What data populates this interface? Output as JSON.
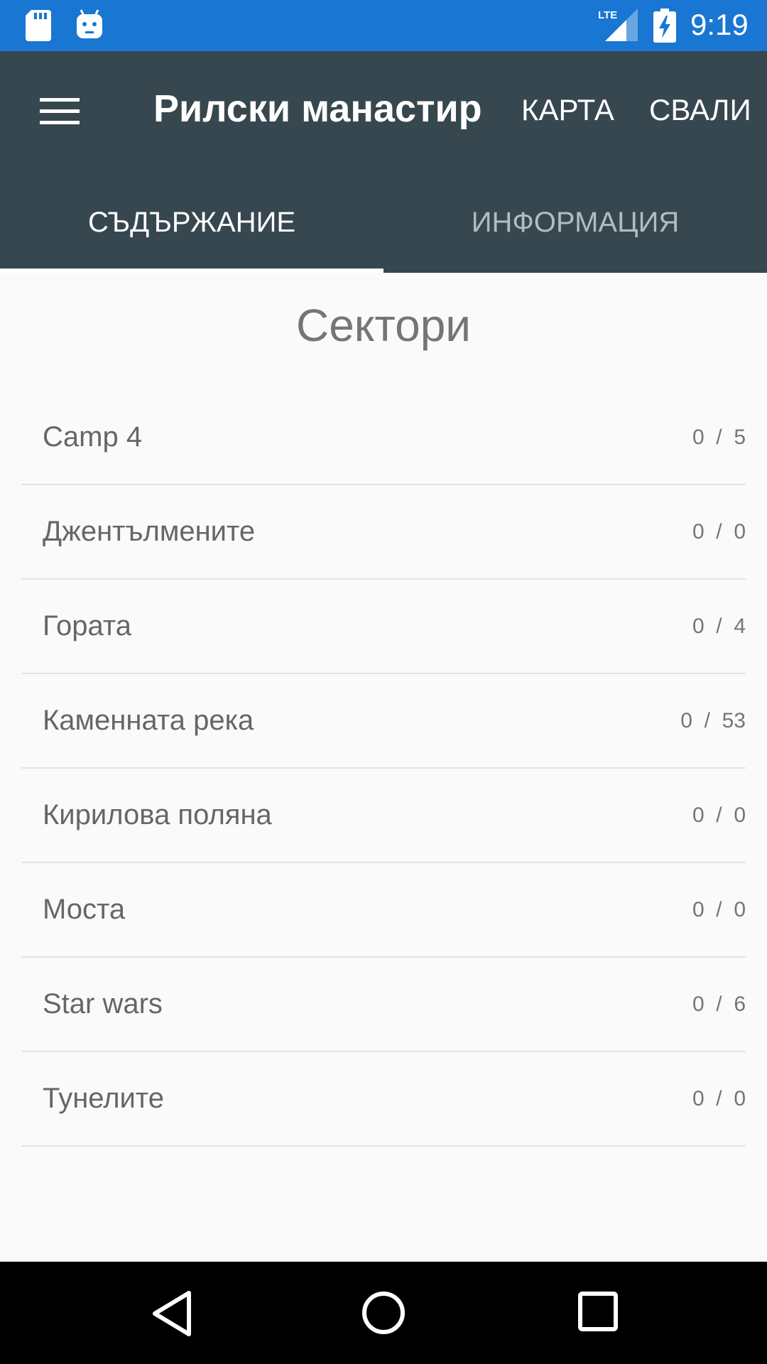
{
  "status_bar": {
    "time": "9:19",
    "network": "LTE",
    "icons": [
      "sd-card-icon",
      "android-debug-icon",
      "lte-signal-icon",
      "battery-charging-icon"
    ]
  },
  "app_bar": {
    "title": "Рилски манастир",
    "actions": {
      "map": "КАРТА",
      "download": "СВАЛИ"
    },
    "menu_icon": "hamburger-menu-icon"
  },
  "tabs": [
    {
      "label": "СЪДЪРЖАНИЕ",
      "selected": true
    },
    {
      "label": "ИНФОРМАЦИЯ",
      "selected": false
    }
  ],
  "main": {
    "section_title": "Сектори",
    "sectors": [
      {
        "name": "Camp 4",
        "count": "0  /  5"
      },
      {
        "name": "Джентълмените",
        "count": "0  /  0"
      },
      {
        "name": "Гората",
        "count": "0  /  4"
      },
      {
        "name": "Каменната река",
        "count": "0  /  53"
      },
      {
        "name": "Кирилова поляна",
        "count": "0  /  0"
      },
      {
        "name": "Моста",
        "count": "0  /  0"
      },
      {
        "name": "Star wars",
        "count": "0  /  6"
      },
      {
        "name": "Тунелите",
        "count": "0  /  0"
      }
    ]
  },
  "nav_bar": {
    "icons": [
      "back-icon",
      "home-icon",
      "recents-icon"
    ]
  },
  "colors": {
    "status_bar": "#1976d2",
    "app_bar": "#37474f",
    "background": "#fafafa",
    "divider": "#e3e3e3"
  }
}
